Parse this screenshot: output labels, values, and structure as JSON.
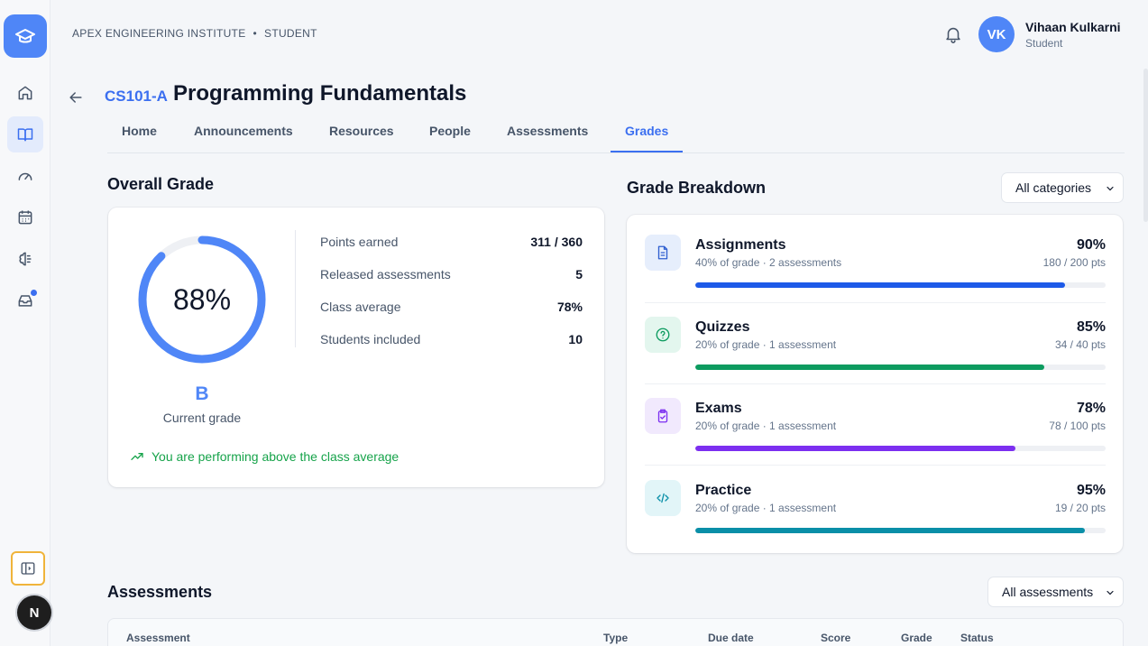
{
  "header": {
    "institute": "APEX ENGINEERING INSTITUTE",
    "role_context": "STUDENT",
    "user": {
      "initials": "VK",
      "name": "Vihaan Kulkarni",
      "role": "Student"
    }
  },
  "sidebar": {
    "items": [
      {
        "icon": "home-icon"
      },
      {
        "icon": "book-open-icon",
        "active": true
      },
      {
        "icon": "gauge-icon"
      },
      {
        "icon": "calendar-icon"
      },
      {
        "icon": "brain-icon"
      },
      {
        "icon": "inbox-icon",
        "badge": true
      }
    ],
    "next_badge": "N"
  },
  "course": {
    "code": "CS101-A",
    "title": "Programming Fundamentals",
    "tabs": [
      {
        "label": "Home"
      },
      {
        "label": "Announcements"
      },
      {
        "label": "Resources"
      },
      {
        "label": "People"
      },
      {
        "label": "Assessments"
      },
      {
        "label": "Grades",
        "active": true
      }
    ]
  },
  "overall": {
    "title": "Overall Grade",
    "percent_label": "88%",
    "percent_value": 88,
    "letter": "B",
    "letter_caption": "Current grade",
    "stats": [
      {
        "label": "Points earned",
        "value": "311 / 360"
      },
      {
        "label": "Released assessments",
        "value": "5"
      },
      {
        "label": "Class average",
        "value": "78%"
      },
      {
        "label": "Students included",
        "value": "10"
      }
    ],
    "trend_text": "You are performing above the class average"
  },
  "breakdown": {
    "title": "Grade Breakdown",
    "filter": "All categories",
    "items": [
      {
        "name": "Assignments",
        "sub": "40% of grade · 2 assessments",
        "pct": "90%",
        "value": 90,
        "pts": "180 / 200 pts",
        "color": "#1d5ae8",
        "icon": "document-icon",
        "icon_bg": "#e6eefc",
        "icon_color": "#2f5fd0"
      },
      {
        "name": "Quizzes",
        "sub": "20% of grade · 1 assessment",
        "pct": "85%",
        "value": 85,
        "pts": "34 / 40 pts",
        "color": "#0c9b5f",
        "icon": "question-circle-icon",
        "icon_bg": "#e3f6ee",
        "icon_color": "#0c9b5f"
      },
      {
        "name": "Exams",
        "sub": "20% of grade · 1 assessment",
        "pct": "78%",
        "value": 78,
        "pts": "78 / 100 pts",
        "color": "#7c2ff0",
        "icon": "clipboard-check-icon",
        "icon_bg": "#f1e9fd",
        "icon_color": "#7c2ff0"
      },
      {
        "name": "Practice",
        "sub": "20% of grade · 1 assessment",
        "pct": "95%",
        "value": 95,
        "pts": "19 / 20 pts",
        "color": "#0a8fa8",
        "icon": "code-icon",
        "icon_bg": "#e2f5f8",
        "icon_color": "#0a8fa8"
      }
    ]
  },
  "assessments": {
    "title": "Assessments",
    "filter": "All assessments",
    "columns": [
      "Assessment",
      "Type",
      "Due date",
      "Score",
      "Grade",
      "Status"
    ]
  }
}
